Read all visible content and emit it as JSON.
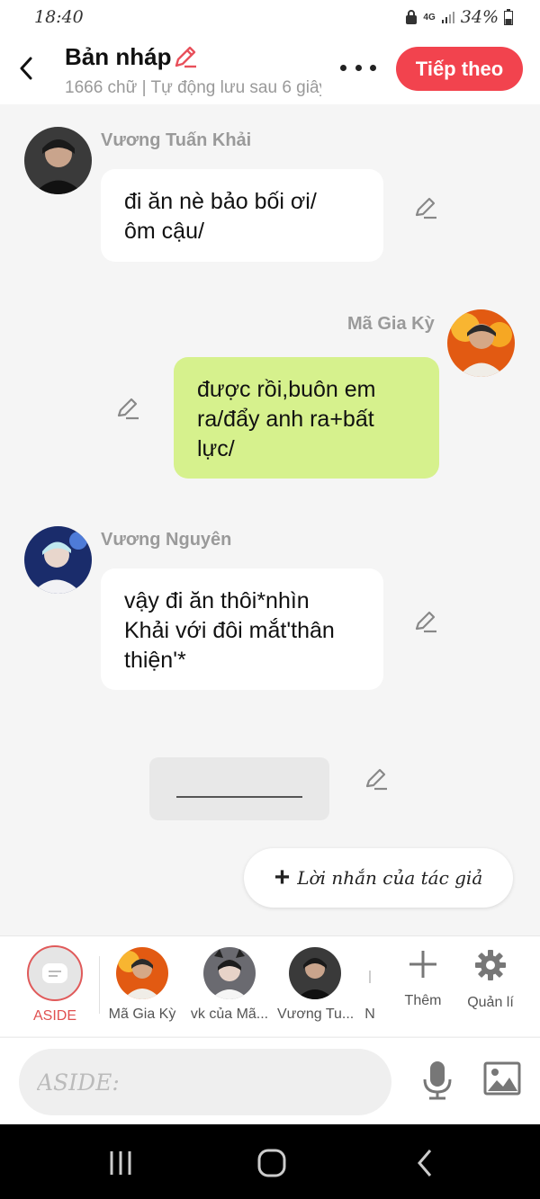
{
  "status": {
    "time": "18:40",
    "network": "4G",
    "battery": "34%"
  },
  "header": {
    "title": "Bản nháp",
    "subtitle": "1666 chữ | Tự động lưu sau 6 giây",
    "next_label": "Tiếp theo"
  },
  "messages": [
    {
      "name": "Vương Tuấn Khải",
      "lines": [
        "đi ăn nè bảo bối ơi/",
        "ôm cậu/"
      ]
    },
    {
      "name": "Mã Gia Kỳ",
      "lines": [
        "được rồi,buôn em",
        "ra/đẩy anh ra+bất",
        "lực/"
      ]
    },
    {
      "name": "Vương Nguyên",
      "lines": [
        "vậy đi ăn thôi*nhìn",
        "Khải với đôi mắt'thân",
        "thiện'*"
      ]
    }
  ],
  "author_note": {
    "plus": "+",
    "label": "Lời nhắn của tác giả"
  },
  "characters": {
    "aside_label": "ASIDE",
    "items": [
      "Mã Gia Kỳ",
      "vk của Mã...",
      "Vương Tu...",
      "N"
    ],
    "add_label": "Thêm",
    "manage_label": "Quản lí"
  },
  "composer": {
    "placeholder": "ASIDE:"
  },
  "colors": {
    "accent": "#f2434e",
    "green_bubble": "#d6f18d"
  }
}
